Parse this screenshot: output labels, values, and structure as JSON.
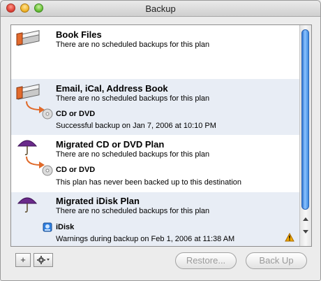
{
  "window": {
    "title": "Backup"
  },
  "plans": [
    {
      "title": "Book Files",
      "status": "There are no scheduled backups for this plan"
    },
    {
      "title": "Email, iCal, Address Book",
      "status": "There are no scheduled backups for this plan",
      "destination": {
        "name": "CD or DVD",
        "status": "Successful backup on Jan 7, 2006 at 10:10 PM"
      }
    },
    {
      "title": "Migrated CD or DVD Plan",
      "status": "There are no scheduled backups for this plan",
      "destination": {
        "name": "CD or DVD",
        "status": "This plan has never been backed up to this destination"
      }
    },
    {
      "title": "Migrated iDisk Plan",
      "status": "There are no scheduled backups for this plan",
      "destination": {
        "name": "iDisk",
        "status": "Warnings during backup on Feb 1, 2006 at 11:38 AM"
      }
    }
  ],
  "toolbar": {
    "add_label": "+",
    "restore_label": "Restore...",
    "backup_label": "Back Up"
  },
  "icons": {
    "plan_icon": "file-stack-icon",
    "migrated_icon": "umbrella-icon",
    "disc_icon": "cd-dvd-icon",
    "idisk_icon": "idisk-icon",
    "warning_icon": "warning-icon",
    "gear_icon": "gear-icon"
  },
  "colors": {
    "accent": "#3f8be0",
    "alternate_row": "#e8edf5",
    "warning": "#f2a900"
  }
}
